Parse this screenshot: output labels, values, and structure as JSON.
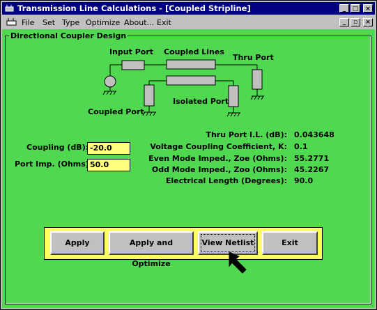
{
  "window": {
    "title": "Transmission Line Calculations - [Coupled Stripline]"
  },
  "menu": {
    "items": [
      {
        "label": "File"
      },
      {
        "label": "Set"
      },
      {
        "label": "Type"
      },
      {
        "label": "Optimize"
      },
      {
        "label": "About..."
      },
      {
        "label": "Exit"
      }
    ]
  },
  "group": {
    "title": "Directional Coupler Design"
  },
  "diagram": {
    "input_port": "Input Port",
    "coupled_lines": "Coupled Lines",
    "thru_port": "Thru Port",
    "coupled_port": "Coupled Port",
    "isolated_port": "Isolated Port"
  },
  "inputs": {
    "coupling_label": "Coupling (dB):",
    "coupling_value": "-20.0",
    "port_imp_label": "Port Imp. (Ohms)",
    "port_imp_value": "50.0"
  },
  "results": [
    {
      "label": "Thru Port I.L. (dB):",
      "value": "0.043648"
    },
    {
      "label": "Voltage Coupling Coefficient, K:",
      "value": "0.1"
    },
    {
      "label": "Even Mode Imped., Zoe (Ohms):",
      "value": "55.2771"
    },
    {
      "label": "Odd Mode Imped., Zoo (Ohms):",
      "value": "45.2267"
    },
    {
      "label": "Electrical Length (Degrees):",
      "value": "90.0"
    }
  ],
  "buttons": {
    "apply": "Apply",
    "apply_optimize": "Apply and Optimize",
    "view_netlist": "View Netlist",
    "exit": "Exit"
  },
  "colors": {
    "background": "#50d850",
    "titlebar": "#000080",
    "input_bg": "#ffff80",
    "button_panel": "#ffff60"
  }
}
